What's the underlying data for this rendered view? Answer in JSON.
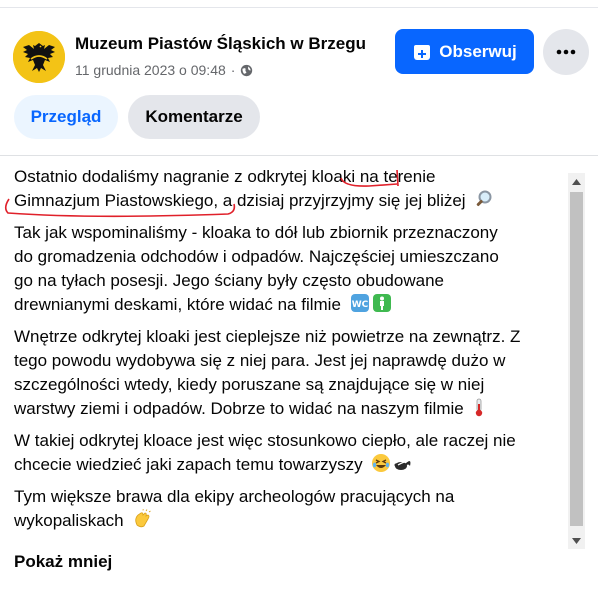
{
  "header": {
    "page_name": "Muzeum Piastów Śląskich w Brzegu",
    "date": "11 grudnia 2023 o 09:48",
    "separator": "·",
    "follow_label": "Obserwuj",
    "more_label": "•••"
  },
  "tabs": [
    {
      "label": "Przegląd",
      "active": true
    },
    {
      "label": "Komentarze",
      "active": false
    }
  ],
  "post": {
    "p1_a": "Ostatnio dodaliśmy nagranie z odkrytej kloaki na terenie",
    "p1_b": "Gimnazjum Piastowskiego, a dzisiaj przyjrzyjmy się jej bliżej",
    "p2_a": "Tak jak wspominaliśmy - kloaka to dół lub zbiornik przeznaczony",
    "p2_b": "do gromadzenia odchodów i odpadów. Najczęściej umieszczano",
    "p2_c": "go na tyłach posesji. Jego ściany były często obudowane",
    "p2_d": "drewnianymi deskami, które widać na filmie",
    "p3_a": "Wnętrze odkrytej kloaki jest cieplejsze niż powietrze na zewnątrz. Z",
    "p3_b": "tego powodu wydobywa się z niej para. Jest jej naprawdę dużo w",
    "p3_c": "szczególności wtedy, kiedy poruszane są znajdujące się w niej",
    "p3_d": "warstwy ziemi i odpadów. Dobrze to widać na naszym filmie",
    "p4_a": "W takiej odkrytej kloace jest więc stosunkowo ciepło, ale raczej nie",
    "p4_b": "chcecie wiedzieć jaki zapach temu towarzyszy",
    "p5_a": "Tym większe brawa dla ekipy archeologów pracujących na",
    "p5_b": "wykopaliskach",
    "show_less": "Pokaż mniej"
  },
  "colors": {
    "brand_blue": "#0866ff",
    "annotation_red": "#e0202a",
    "scrollbar_thumb": "#c1c1c1"
  },
  "icons": [
    "page-avatar-eagle",
    "globe-icon",
    "follow-icon",
    "more-icon",
    "magnifier-emoji",
    "wc-emoji",
    "restroom-emoji",
    "thermometer-emoji",
    "laughing-emoji",
    "skunk-emoji",
    "clap-emoji"
  ]
}
